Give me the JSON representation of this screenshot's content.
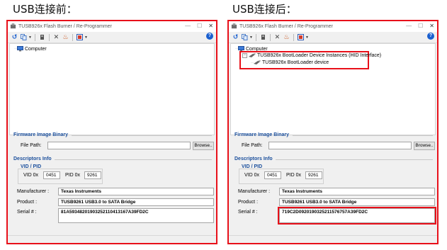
{
  "captions": {
    "left": "USB连接前：",
    "right": "USB连接后："
  },
  "window": {
    "title": "TUSB926x Flash Burner / Re-Programmer",
    "controls": {
      "minimize": "—",
      "maximize": "☐",
      "close": "✕"
    }
  },
  "toolbar": {
    "help": "?"
  },
  "tree": {
    "computer": "Computer",
    "instances": "TUSB926x BootLoader Device Instances (HID Interface)",
    "device": "TUSB926x BootLoader device",
    "expander": "−"
  },
  "firmware": {
    "section": "Firmware Image Binary",
    "file_path_label": "File Path:",
    "file_path_value": "",
    "browse": "Browse.."
  },
  "descriptors": {
    "section": "Descriptors Info",
    "group": "VID / PID",
    "vid_label": "VID 0x",
    "vid": "0451",
    "pid_label": "PID 0x",
    "pid": "9261",
    "manufacturer_label": "Manufacturer :",
    "manufacturer": "Texas Instruments",
    "product_label": "Product :",
    "product": "TUSB9261 USB3.0 to SATA Bridge",
    "serial_label": "Serial # :"
  },
  "before": {
    "serial": "81A59348201903252110413167A39FD2C"
  },
  "after": {
    "serial": "719C2D0920190325211576757A39FD2C"
  },
  "colors": {
    "highlight": "#e8101a",
    "section": "#1b4f9c"
  }
}
